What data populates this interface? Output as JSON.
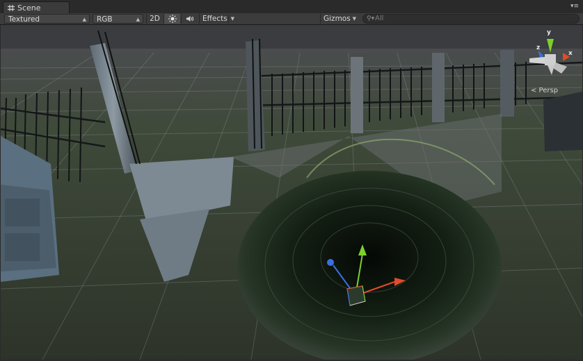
{
  "window": {
    "tab_label": "Scene",
    "tab_icon": "grid-icon"
  },
  "toolbar": {
    "shading_mode": "Textured",
    "render_mode": "RGB",
    "mode_2d_label": "2D",
    "lighting_icon": "sun-icon",
    "audio_icon": "speaker-icon",
    "effects_label": "Effects",
    "gizmos_label": "Gizmos",
    "search_placeholder": "All"
  },
  "gizmo": {
    "y_label": "y",
    "x_label": "x",
    "z_label": "z",
    "projection_label": "< Persp"
  },
  "colors": {
    "x_axis": "#e04b2c",
    "y_axis": "#7bd02c",
    "z_axis": "#3b6fe0"
  }
}
